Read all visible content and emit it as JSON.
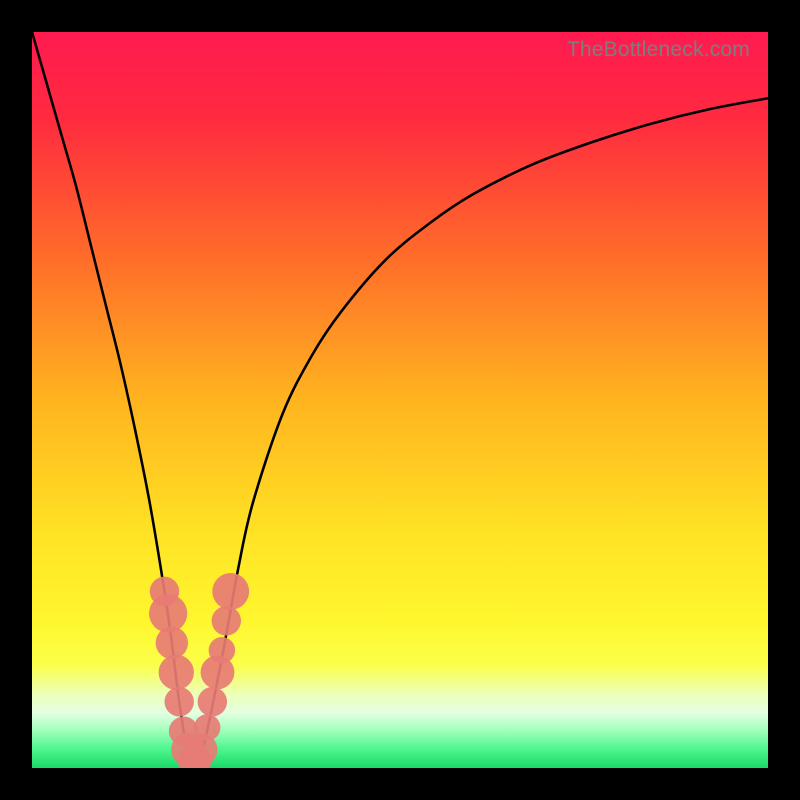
{
  "watermark": {
    "text": "TheBottleneck.com"
  },
  "colors": {
    "frame": "#000000",
    "gradient_stops": [
      {
        "offset": 0.0,
        "color": "#ff1a50"
      },
      {
        "offset": 0.12,
        "color": "#ff2b3f"
      },
      {
        "offset": 0.3,
        "color": "#ff6a2a"
      },
      {
        "offset": 0.5,
        "color": "#ffb41f"
      },
      {
        "offset": 0.68,
        "color": "#ffe224"
      },
      {
        "offset": 0.8,
        "color": "#fff72e"
      },
      {
        "offset": 0.86,
        "color": "#fbff4a"
      },
      {
        "offset": 0.9,
        "color": "#ecffb9"
      },
      {
        "offset": 0.925,
        "color": "#e4ffe2"
      },
      {
        "offset": 0.95,
        "color": "#9dffb9"
      },
      {
        "offset": 0.975,
        "color": "#4bf58d"
      },
      {
        "offset": 1.0,
        "color": "#1bd968"
      }
    ],
    "curve": "#000000",
    "bead": "#e77c75"
  },
  "chart_data": {
    "type": "line",
    "title": "",
    "xlabel": "",
    "ylabel": "",
    "xlim": [
      0,
      100
    ],
    "ylim": [
      0,
      100
    ],
    "grid": false,
    "legend": false,
    "series": [
      {
        "name": "bottleneck-curve",
        "x": [
          0,
          2,
          4,
          6,
          8,
          10,
          12,
          14,
          16,
          18,
          19,
          20,
          21,
          22,
          23,
          24,
          26,
          28,
          30,
          34,
          38,
          42,
          48,
          54,
          60,
          68,
          76,
          84,
          92,
          100
        ],
        "y": [
          100,
          93,
          86,
          79,
          71,
          63,
          55,
          46,
          36,
          24,
          17,
          9,
          3,
          0.5,
          2,
          6,
          16,
          27,
          36,
          48,
          56,
          62,
          69,
          74,
          78,
          82,
          85,
          87.5,
          89.5,
          91
        ]
      }
    ],
    "markers": [
      {
        "x": 18.0,
        "y": 24,
        "r": 2.0
      },
      {
        "x": 18.5,
        "y": 21,
        "r": 2.6
      },
      {
        "x": 19.0,
        "y": 17,
        "r": 2.2
      },
      {
        "x": 19.6,
        "y": 13,
        "r": 2.4
      },
      {
        "x": 20.0,
        "y": 9,
        "r": 2.0
      },
      {
        "x": 20.6,
        "y": 5,
        "r": 2.0
      },
      {
        "x": 21.2,
        "y": 2.5,
        "r": 2.3
      },
      {
        "x": 21.8,
        "y": 1.0,
        "r": 2.0
      },
      {
        "x": 22.4,
        "y": 1.0,
        "r": 2.0
      },
      {
        "x": 23.0,
        "y": 2.5,
        "r": 2.2
      },
      {
        "x": 23.8,
        "y": 5.5,
        "r": 1.8
      },
      {
        "x": 24.5,
        "y": 9,
        "r": 2.0
      },
      {
        "x": 25.2,
        "y": 13,
        "r": 2.3
      },
      {
        "x": 25.8,
        "y": 16,
        "r": 1.8
      },
      {
        "x": 26.4,
        "y": 20,
        "r": 2.0
      },
      {
        "x": 27.0,
        "y": 24,
        "r": 2.5
      }
    ]
  }
}
